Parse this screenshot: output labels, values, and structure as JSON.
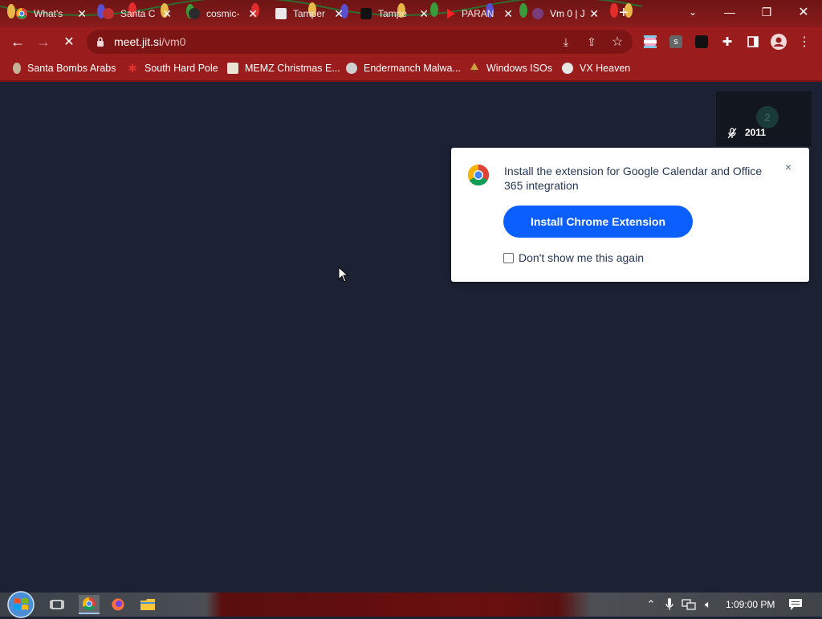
{
  "browser": {
    "tabs": [
      {
        "title": "What's",
        "icon": "chrome-icon",
        "active": false
      },
      {
        "title": "Santa C",
        "icon": "santa-icon",
        "active": false
      },
      {
        "title": "cosmic-",
        "icon": "github-icon",
        "active": false
      },
      {
        "title": "Tamper",
        "icon": "tampermonkey-icon",
        "active": false
      },
      {
        "title": "Tampe",
        "icon": "tampermonkey-dark-icon",
        "active": false
      },
      {
        "title": "PARAN",
        "icon": "youtube-icon",
        "active": false
      },
      {
        "title": "Vm 0 | J",
        "icon": "jitsi-icon",
        "active": true
      }
    ],
    "url_host": "meet.jit.si",
    "url_path": "/vm0"
  },
  "bookmarks": [
    {
      "label": "Santa Bombs Arabs",
      "icon": "santa-bomb-icon"
    },
    {
      "label": "South Hard Pole",
      "icon": "snowflake-icon"
    },
    {
      "label": "MEMZ Christmas E...",
      "icon": "memz-icon"
    },
    {
      "label": "Endermanch Malwa...",
      "icon": "raccoon-icon"
    },
    {
      "label": "Windows ISOs",
      "icon": "tree-icon"
    },
    {
      "label": "VX Heaven",
      "icon": "vx-heaven-icon"
    }
  ],
  "meeting": {
    "participant_initial": "2",
    "participant_name": "2011"
  },
  "popup": {
    "message": "Install the extension for Google Calendar and Office 365 integration",
    "install_label": "Install Chrome Extension",
    "dont_show_label": "Don't show me this again",
    "close_label": "×"
  },
  "taskbar": {
    "clock": "1:09:00 PM"
  },
  "colors": {
    "theme_red": "#9a1c1c",
    "meeting_bg": "#1c2233",
    "install_blue": "#0b5fff"
  }
}
